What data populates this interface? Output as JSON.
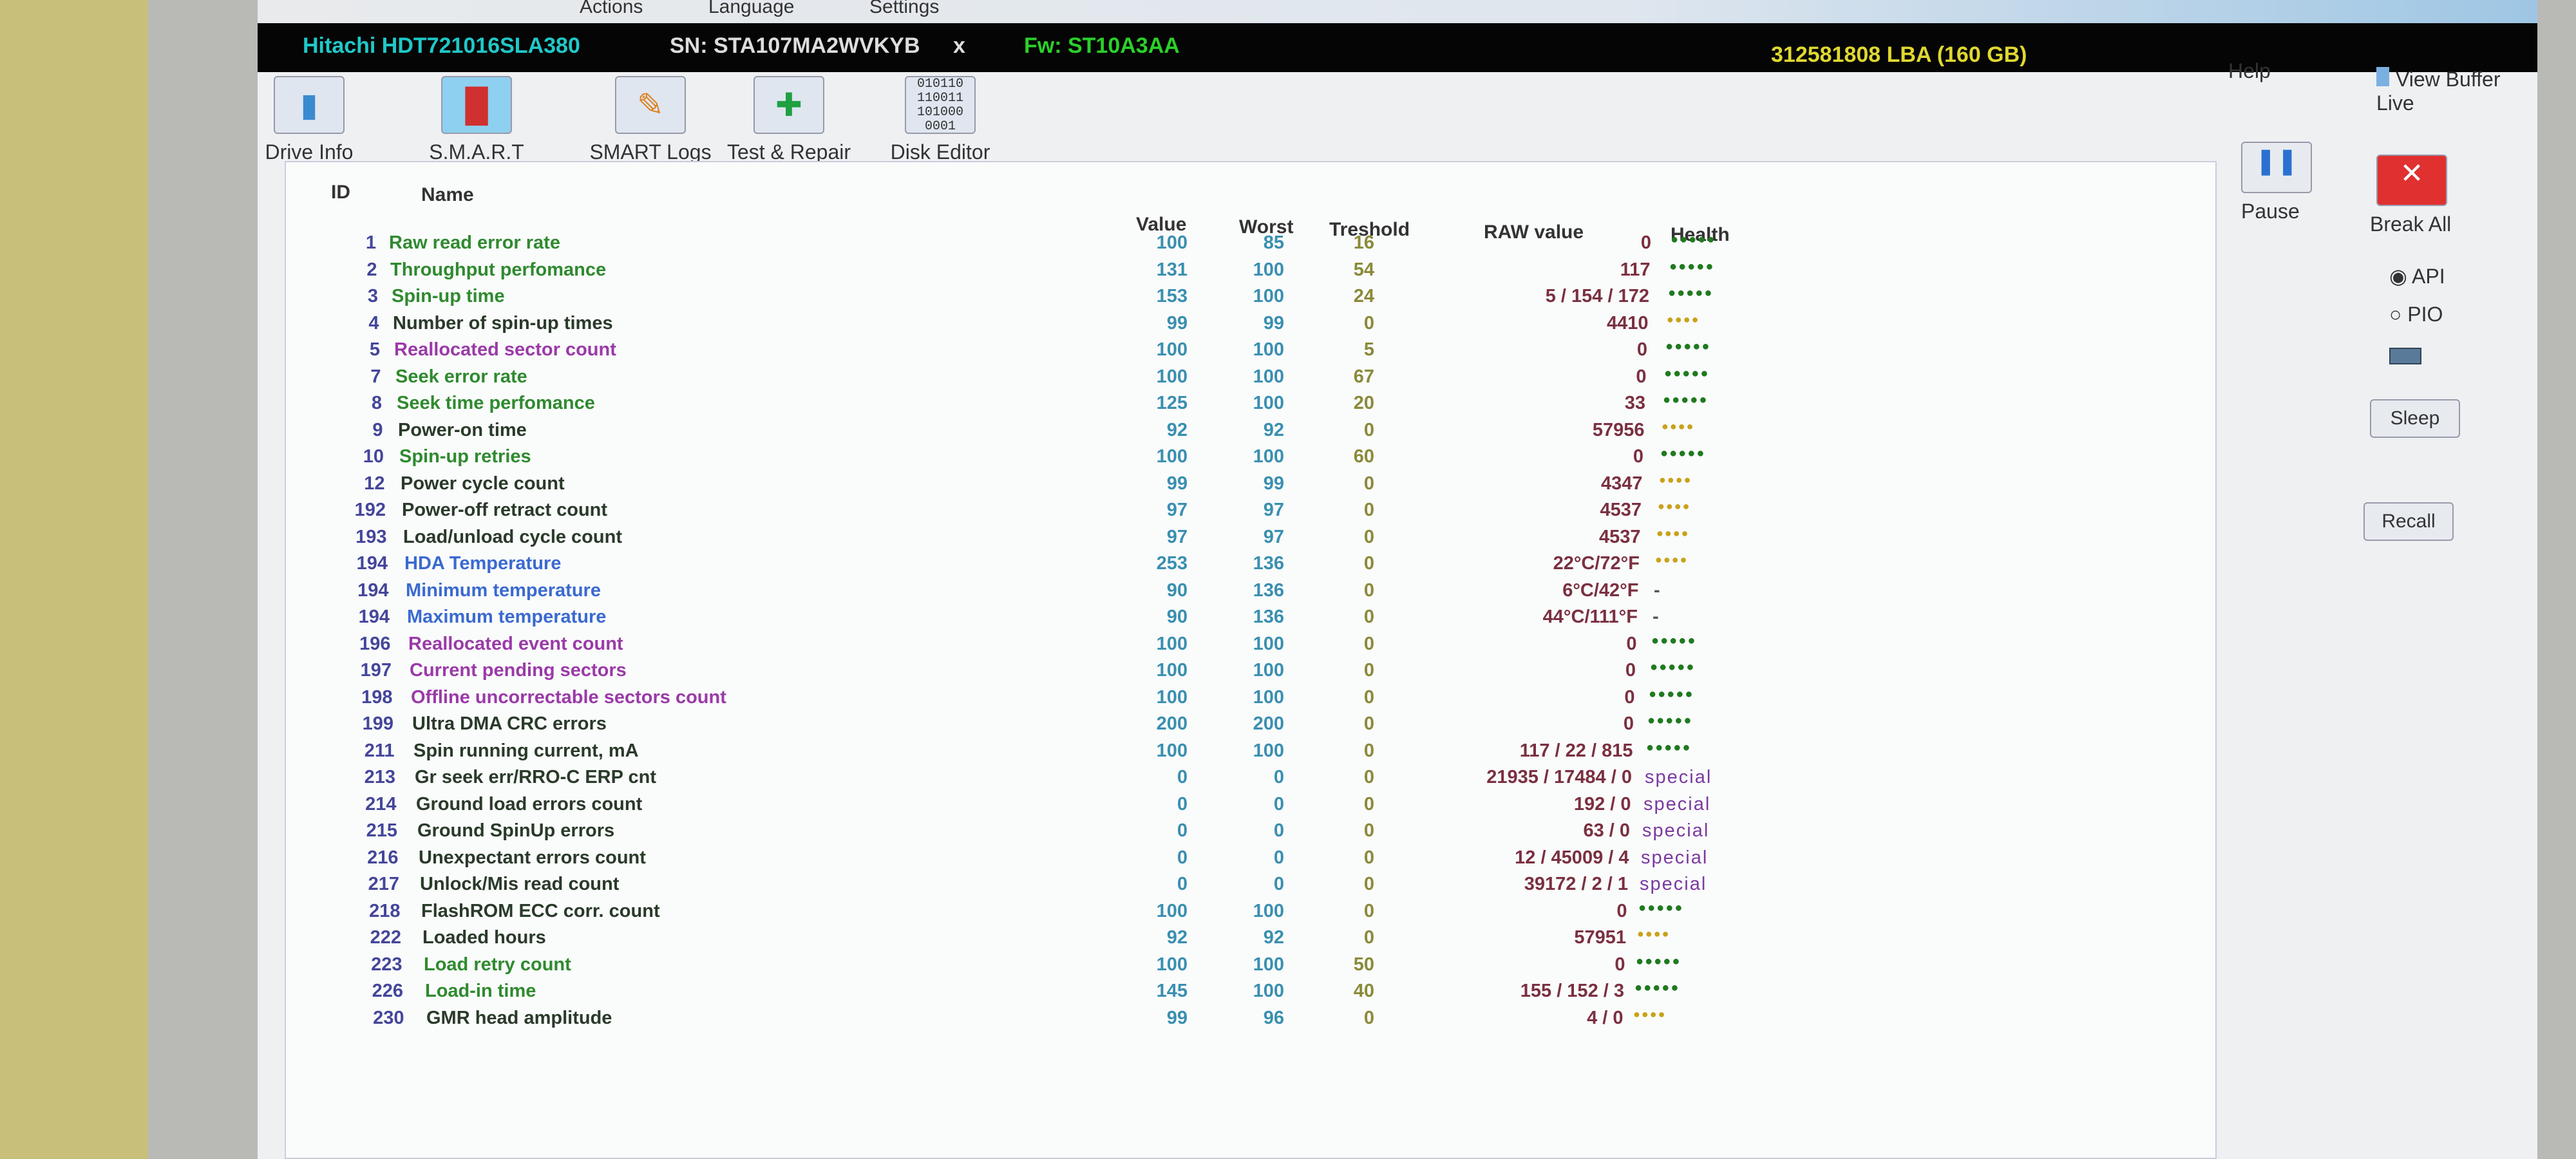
{
  "menu": [
    "Actions",
    "Language",
    "Settings"
  ],
  "drive": {
    "model": "Hitachi HDT721016SLA380",
    "serial": "SN: STA107MA2WVKYB",
    "close": "x",
    "firmware": "Fw: ST10A3AA",
    "capacity": "312581808 LBA (160 GB)"
  },
  "top": {
    "help": "Help",
    "view_buffer": "View Buffer Live"
  },
  "toolbar": [
    {
      "label": "Drive Info",
      "icon": "drive-info-icon"
    },
    {
      "label": "S.M.A.R.T",
      "icon": "smart-icon"
    },
    {
      "label": "SMART Logs",
      "icon": "smart-logs-icon"
    },
    {
      "label": "Test & Repair",
      "icon": "test-repair-icon"
    },
    {
      "label": "Disk Editor",
      "icon": "disk-editor-icon"
    }
  ],
  "side": {
    "pause": "Pause",
    "break_all": "Break All",
    "api": "API",
    "pio": "PIO",
    "sleep": "Sleep",
    "recall": "Recall",
    "mode_selected": "API"
  },
  "columns": {
    "id": "ID",
    "name": "Name",
    "value": "Value",
    "worst": "Worst",
    "threshold": "Treshold",
    "raw": "RAW value",
    "health": "Health"
  },
  "colors": {
    "good": "#1f7a1f",
    "warn": "#c9a21a",
    "special": "#7a3aa0"
  },
  "rows": [
    {
      "id": "1",
      "name": "Raw read error rate",
      "value": "100",
      "worst": "85",
      "threshold": "16",
      "raw": "0",
      "health": "good5",
      "color": "#2f8a2f"
    },
    {
      "id": "2",
      "name": "Throughput perfomance",
      "value": "131",
      "worst": "100",
      "threshold": "54",
      "raw": "117",
      "health": "good5",
      "color": "#2f8a2f"
    },
    {
      "id": "3",
      "name": "Spin-up time",
      "value": "153",
      "worst": "100",
      "threshold": "24",
      "raw": "5 / 154 / 172",
      "health": "good5",
      "color": "#2f8a2f"
    },
    {
      "id": "4",
      "name": "Number of spin-up times",
      "value": "99",
      "worst": "99",
      "threshold": "0",
      "raw": "4410",
      "health": "warn4",
      "color": "#2a3a2a"
    },
    {
      "id": "5",
      "name": "Reallocated sector count",
      "value": "100",
      "worst": "100",
      "threshold": "5",
      "raw": "0",
      "health": "good5",
      "color": "#9a3aa8"
    },
    {
      "id": "7",
      "name": "Seek error rate",
      "value": "100",
      "worst": "100",
      "threshold": "67",
      "raw": "0",
      "health": "good5",
      "color": "#2f8a2f"
    },
    {
      "id": "8",
      "name": "Seek time perfomance",
      "value": "125",
      "worst": "100",
      "threshold": "20",
      "raw": "33",
      "health": "good5",
      "color": "#2f8a2f"
    },
    {
      "id": "9",
      "name": "Power-on time",
      "value": "92",
      "worst": "92",
      "threshold": "0",
      "raw": "57956",
      "health": "warn4",
      "color": "#2a3a2a"
    },
    {
      "id": "10",
      "name": "Spin-up retries",
      "value": "100",
      "worst": "100",
      "threshold": "60",
      "raw": "0",
      "health": "good5",
      "color": "#2f8a2f"
    },
    {
      "id": "12",
      "name": "Power cycle count",
      "value": "99",
      "worst": "99",
      "threshold": "0",
      "raw": "4347",
      "health": "warn4",
      "color": "#2a3a2a"
    },
    {
      "id": "192",
      "name": "Power-off retract count",
      "value": "97",
      "worst": "97",
      "threshold": "0",
      "raw": "4537",
      "health": "warn4",
      "color": "#2a3a2a"
    },
    {
      "id": "193",
      "name": "Load/unload cycle count",
      "value": "97",
      "worst": "97",
      "threshold": "0",
      "raw": "4537",
      "health": "warn4",
      "color": "#2a3a2a"
    },
    {
      "id": "194",
      "name": "HDA Temperature",
      "value": "253",
      "worst": "136",
      "threshold": "0",
      "raw": "22°C/72°F",
      "health": "warn4",
      "color": "#3a6ad0"
    },
    {
      "id": "194",
      "name": "Minimum temperature",
      "value": "90",
      "worst": "136",
      "threshold": "0",
      "raw": "6°C/42°F",
      "health": "-",
      "color": "#3a6ad0"
    },
    {
      "id": "194",
      "name": "Maximum temperature",
      "value": "90",
      "worst": "136",
      "threshold": "0",
      "raw": "44°C/111°F",
      "health": "-",
      "color": "#3a6ad0"
    },
    {
      "id": "196",
      "name": "Reallocated event count",
      "value": "100",
      "worst": "100",
      "threshold": "0",
      "raw": "0",
      "health": "good5",
      "color": "#9a3aa8"
    },
    {
      "id": "197",
      "name": "Current pending sectors",
      "value": "100",
      "worst": "100",
      "threshold": "0",
      "raw": "0",
      "health": "good5",
      "color": "#9a3aa8"
    },
    {
      "id": "198",
      "name": "Offline uncorrectable sectors count",
      "value": "100",
      "worst": "100",
      "threshold": "0",
      "raw": "0",
      "health": "good5",
      "color": "#9a3aa8"
    },
    {
      "id": "199",
      "name": "Ultra DMA CRC errors",
      "value": "200",
      "worst": "200",
      "threshold": "0",
      "raw": "0",
      "health": "good5",
      "color": "#2a3a2a"
    },
    {
      "id": "211",
      "name": "Spin running current, mA",
      "value": "100",
      "worst": "100",
      "threshold": "0",
      "raw": "117 / 22 / 815",
      "health": "good5",
      "color": "#2a3a2a"
    },
    {
      "id": "213",
      "name": "Gr seek err/RRO-C ERP cnt",
      "value": "0",
      "worst": "0",
      "threshold": "0",
      "raw": "21935 / 17484 / 0",
      "health": "special",
      "color": "#2a3a2a"
    },
    {
      "id": "214",
      "name": "Ground load errors count",
      "value": "0",
      "worst": "0",
      "threshold": "0",
      "raw": "192 / 0",
      "health": "special",
      "color": "#2a3a2a"
    },
    {
      "id": "215",
      "name": "Ground SpinUp errors",
      "value": "0",
      "worst": "0",
      "threshold": "0",
      "raw": "63 / 0",
      "health": "special",
      "color": "#2a3a2a"
    },
    {
      "id": "216",
      "name": "Unexpectant errors count",
      "value": "0",
      "worst": "0",
      "threshold": "0",
      "raw": "12 / 45009 / 4",
      "health": "special",
      "color": "#2a3a2a"
    },
    {
      "id": "217",
      "name": "Unlock/Mis read count",
      "value": "0",
      "worst": "0",
      "threshold": "0",
      "raw": "39172 / 2 / 1",
      "health": "special",
      "color": "#2a3a2a"
    },
    {
      "id": "218",
      "name": "FlashROM ECC corr. count",
      "value": "100",
      "worst": "100",
      "threshold": "0",
      "raw": "0",
      "health": "good5",
      "color": "#2a3a2a"
    },
    {
      "id": "222",
      "name": "Loaded hours",
      "value": "92",
      "worst": "92",
      "threshold": "0",
      "raw": "57951",
      "health": "warn4",
      "color": "#2a3a2a"
    },
    {
      "id": "223",
      "name": "Load retry count",
      "value": "100",
      "worst": "100",
      "threshold": "50",
      "raw": "0",
      "health": "good5",
      "color": "#2f8a2f"
    },
    {
      "id": "226",
      "name": "Load-in time",
      "value": "145",
      "worst": "100",
      "threshold": "40",
      "raw": "155 / 152 / 3",
      "health": "good5",
      "color": "#2f8a2f"
    },
    {
      "id": "230",
      "name": "GMR head amplitude",
      "value": "99",
      "worst": "96",
      "threshold": "0",
      "raw": "4 / 0",
      "health": "warn4",
      "color": "#2a3a2a"
    }
  ]
}
